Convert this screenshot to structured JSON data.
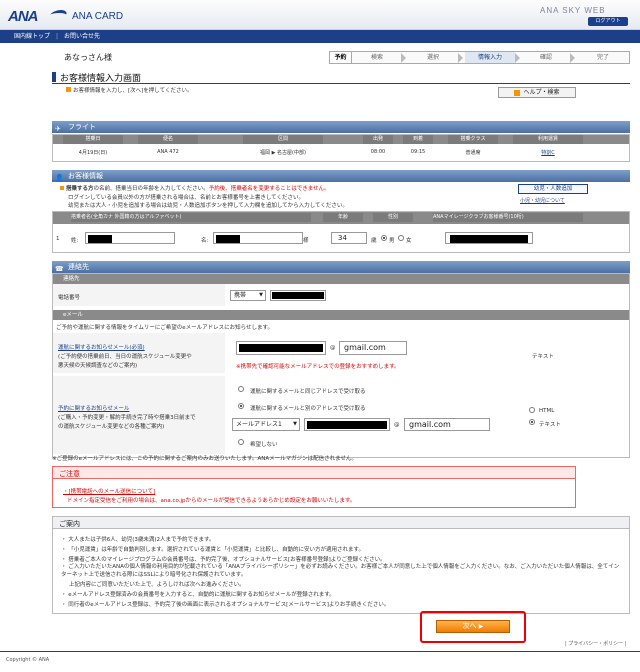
{
  "header": {
    "logo": "ANA",
    "card": "ANA CARD",
    "skyweb": "ANA SKY WEB",
    "logout": "ログアウト"
  },
  "nav": {
    "domestic_top": "国内線トップ",
    "contact": "お問い合せ先"
  },
  "user": {
    "name": "あなっさん様"
  },
  "steps": {
    "label": "予約",
    "items": [
      "検索",
      "選択",
      "情報入力",
      "確認",
      "完了"
    ],
    "current": 2
  },
  "page": {
    "title": "お客様情報入力画面",
    "instruction": "お客様情報を入力し、[次へ]を押してください。",
    "help": "ヘルプ・検索"
  },
  "flight": {
    "section": "フライト",
    "headers": [
      "搭乗日",
      "便名",
      "区間",
      "出発",
      "到着",
      "搭乗クラス",
      "利用運賃"
    ],
    "row": [
      "4月19日(日)",
      "ANA 472",
      "福岡 ▶ 名古屋(中部)",
      "08:00",
      "09:15",
      "普通席",
      "特割C"
    ]
  },
  "passenger": {
    "section": "お客様情報",
    "note1a": "搭乗する方",
    "note1b": "の名前、搭乗当日の年齢を入力してください。",
    "note1c": "予約後、搭乗者名を変更することはできません。",
    "note2": "ログインしている会員以外の方が搭乗される場合は、名前とお客様番号を上書きしてください。",
    "note3": "幼児または大人・小児を追加する場合は幼児・人数追加ボタンを押して入力欄を追加してから入力してください。",
    "add_btn": "幼児・人数追加",
    "add_link": "小児・幼児について",
    "headers": [
      "搭乗者名(全角カナ 外国籍の方はアルファベット)",
      "年齢",
      "性別",
      "ANAマイレージクラブお客様番号(10桁)"
    ],
    "row_no": "1",
    "sei": "姓:",
    "mei": "名:",
    "sama": "様",
    "age": "34",
    "age_unit": "歳",
    "male": "男",
    "female": "女"
  },
  "contact": {
    "section": "連絡先",
    "contact_bar": "連絡先",
    "phone_label": "電話番号",
    "phone_type": "携帯",
    "email_bar": "eメール",
    "email_desc": "ご予約や運航に関する情報をタイムリーにご希望のeメールアドレスにお知らせします。",
    "ops_link": "運航に関するお知らせメール(必須)",
    "ops_desc1": "(ご予約便の搭乗前日、当日の運航スケジュール変更や",
    "ops_desc2": "悪天候の天候調査などのご案内)",
    "ops_domain": "gmail.com",
    "ops_note": "※携帯先で確認可能なメールアドレスでの登録をおすすめします。",
    "ops_format": "テキスト",
    "rsv_link": "予約に関するお知らせメール",
    "rsv_desc1": "(ご購入・予約変更・解約手続き完了時や搭乗3日前まで",
    "rsv_desc2": "の運航スケジュール変更などの各種ご案内)",
    "opt_same": "運航に関するメールと同じアドレスで受け取る",
    "opt_diff": "運航に関するメールと別のアドレスで受け取る",
    "addr_select": "メールアドレス1",
    "rsv_domain": "gmail.com",
    "opt_none": "希望しない",
    "fmt_html": "HTML",
    "fmt_text": "テキスト",
    "footnote": "※ご登録のeメールアドレスには、この予約に関するご案内のみお送りいたします。ANAメールマガジンは配信されません。"
  },
  "caution": {
    "title": "ご注意",
    "line1": "・[携帯電話へのメール送信について]",
    "line2": "ドメイン指定受信をご利用の場合は、ana.co.jpからのメールが受信できるようあらかじめ設定をお願いいたします。"
  },
  "guide": {
    "title": "ご案内",
    "items": [
      "大人または子供6人、幼児(3歳未満)2人まで予約できます。",
      "「小児運賃」は年齢で自動判別します。選択されている運賃と「小児運賃」と比較し、自動的に安い方が適用されます。",
      "搭乗者ご本人のマイレージプログラムの会員番号は、予約完了後、オプショナルサービス[お客様番号登録]よりご登録ください。",
      "ご入力いただいたANAの個人情報の利用目的が記載されている「ANAプライバシーポリシー」を必ずお読みください。お客様ご本人が同意した上で個人情報をご入力ください。なお、ご入力いただいた個人情報は、全てインターネット上で送信される際にはSSLにより暗号化され保護されています。",
      "上記内容にご同意いただいた上で、よろしければ次へお進みください。",
      "eメールアドレス登録済みの会員番号を入力すると、自動的に運航に関するお知らせメールが登録されます。",
      "同行者のeメールアドレス登録は、予約完了後の画面に表示されるオプショナルサービス[メールサービス]よりお手続きください。"
    ]
  },
  "actions": {
    "next": "次へ"
  },
  "footer": {
    "privacy": "| プライバシー・ポリシー |",
    "copyright": "Copyright © ANA"
  }
}
